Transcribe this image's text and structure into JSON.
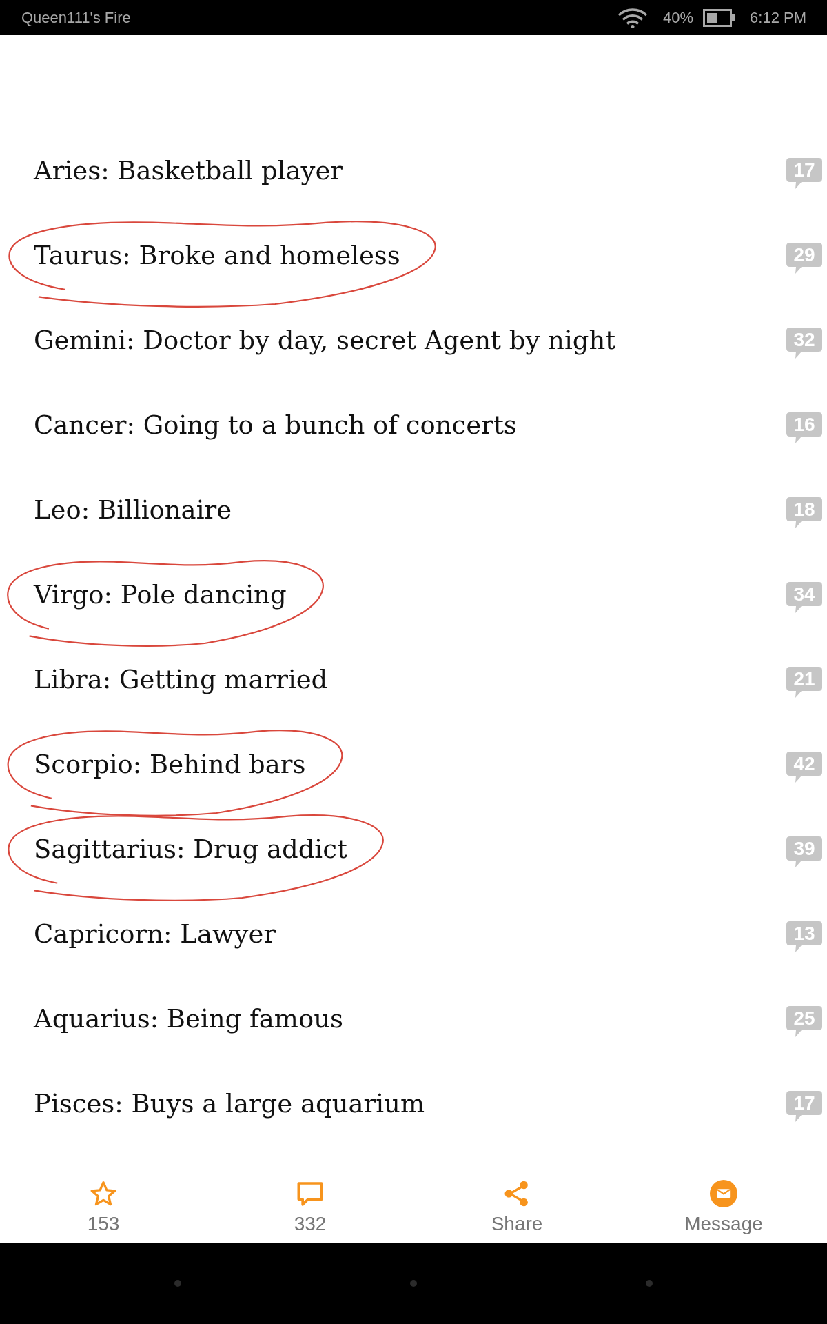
{
  "status_bar": {
    "device_name": "Queen111's Fire",
    "battery": "40%",
    "time": "6:12 PM"
  },
  "rows": [
    {
      "text": "Aries: Basketball player",
      "comments": "17",
      "circled": false
    },
    {
      "text": "Taurus: Broke and homeless",
      "comments": "29",
      "circled": true
    },
    {
      "text": "Gemini: Doctor by day, secret Agent by night",
      "comments": "32",
      "circled": false
    },
    {
      "text": "Cancer: Going to a bunch of concerts",
      "comments": "16",
      "circled": false
    },
    {
      "text": "Leo: Billionaire",
      "comments": "18",
      "circled": false
    },
    {
      "text": "Virgo: Pole dancing",
      "comments": "34",
      "circled": true
    },
    {
      "text": "Libra: Getting married",
      "comments": "21",
      "circled": false
    },
    {
      "text": "Scorpio: Behind bars",
      "comments": "42",
      "circled": true
    },
    {
      "text": "Sagittarius: Drug addict",
      "comments": "39",
      "circled": true
    },
    {
      "text": "Capricorn: Lawyer",
      "comments": "13",
      "circled": false
    },
    {
      "text": "Aquarius: Being famous",
      "comments": "25",
      "circled": false
    },
    {
      "text": "Pisces: Buys a large aquarium",
      "comments": "17",
      "circled": false
    }
  ],
  "action_bar": [
    {
      "kind": "star",
      "label": "153"
    },
    {
      "kind": "comment",
      "label": "332"
    },
    {
      "kind": "share",
      "label": "Share"
    },
    {
      "kind": "message",
      "label": "Message"
    }
  ]
}
